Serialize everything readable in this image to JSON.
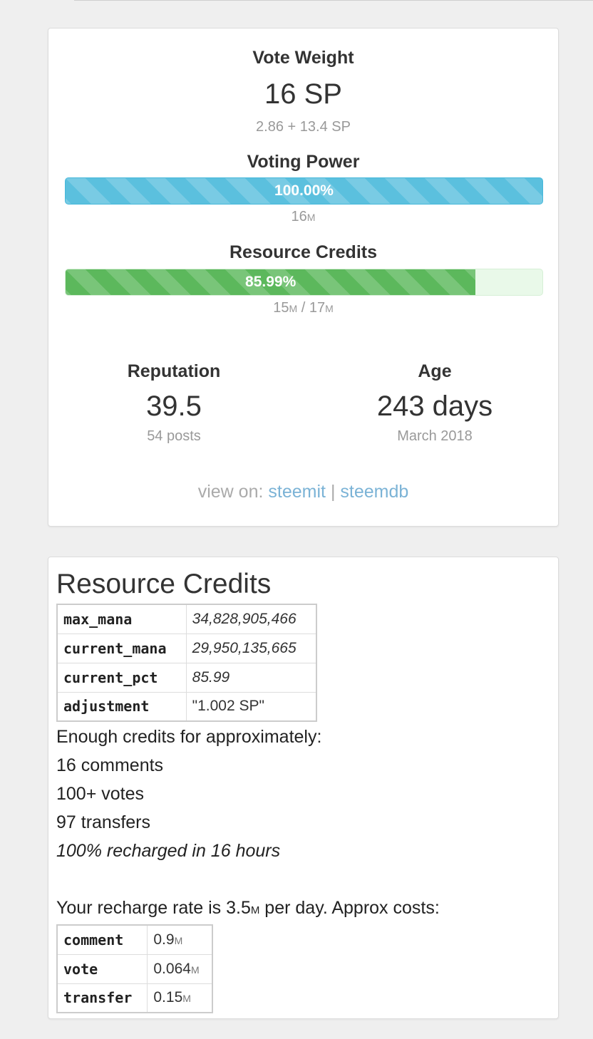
{
  "vote_weight": {
    "title": "Vote Weight",
    "value": "16 SP",
    "breakdown": "2.86 + 13.4 SP"
  },
  "voting_power": {
    "title": "Voting Power",
    "percent": 100.0,
    "label": "100.00%",
    "sub_value": "16",
    "sub_unit": "M"
  },
  "resource_credits_bar": {
    "title": "Resource Credits",
    "percent": 85.99,
    "label": "85.99%",
    "current": "15",
    "current_unit": "M",
    "separator": "/",
    "max": "17",
    "max_unit": "M"
  },
  "reputation": {
    "title": "Reputation",
    "value": "39.5",
    "sub": "54 posts"
  },
  "age": {
    "title": "Age",
    "value": "243 days",
    "sub": "March 2018"
  },
  "view_on": {
    "prefix": "view on:",
    "link1": "steemit",
    "separator": "|",
    "link2": "steemdb"
  },
  "rc_section": {
    "title": "Resource Credits",
    "table": [
      {
        "key": "max_mana",
        "value": "34,828,905,466"
      },
      {
        "key": "current_mana",
        "value": "29,950,135,665"
      },
      {
        "key": "current_pct",
        "value": "85.99"
      },
      {
        "key": "adjustment",
        "value": "\"1.002 SP\""
      }
    ],
    "enough_line": "Enough credits for approximately:",
    "comments": "16 comments",
    "votes": "100+ votes",
    "transfers": "97 transfers",
    "recharged": "100% recharged in 16 hours",
    "recharge_prefix": "Your recharge rate is 3.5",
    "recharge_unit": "M",
    "recharge_suffix": " per day. Approx costs:",
    "costs": [
      {
        "key": "comment",
        "value": "0.9",
        "unit": "M"
      },
      {
        "key": "vote",
        "value": "0.064",
        "unit": "M"
      },
      {
        "key": "transfer",
        "value": "0.15",
        "unit": "M"
      }
    ]
  }
}
